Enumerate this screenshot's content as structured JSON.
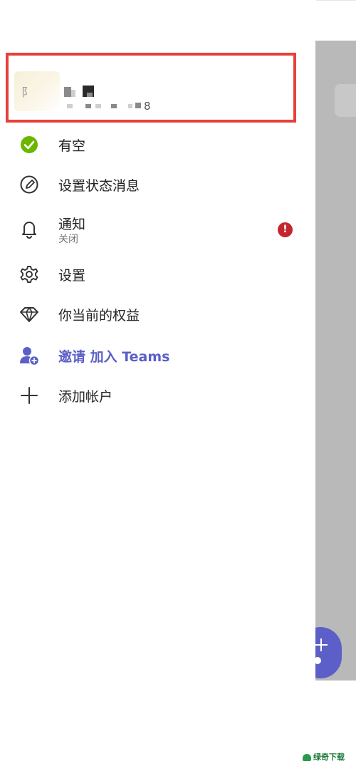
{
  "profile": {
    "avatar_letter": "阝",
    "phone_suffix": "8"
  },
  "menu": {
    "status": {
      "label": "有空"
    },
    "set_status_message": {
      "label": "设置状态消息"
    },
    "notifications": {
      "label": "通知",
      "sub": "关闭",
      "badge": "!"
    },
    "settings": {
      "label": "设置"
    },
    "benefits": {
      "label": "你当前的权益"
    },
    "invite": {
      "label": "邀请 加入 Teams"
    },
    "add_account": {
      "label": "添加帐户"
    }
  },
  "watermark": {
    "text": "绿奇下载"
  },
  "colors": {
    "accent": "#5b5fc7",
    "available": "#6bb700",
    "alert": "#c4262e",
    "highlight_frame": "#e8403a"
  },
  "icons": {
    "status": "available-check-icon",
    "set_status_message": "edit-pen-icon",
    "notifications": "bell-icon",
    "settings": "gear-icon",
    "benefits": "diamond-icon",
    "invite": "person-add-icon",
    "add_account": "plus-icon",
    "fab": "plus-icon"
  }
}
